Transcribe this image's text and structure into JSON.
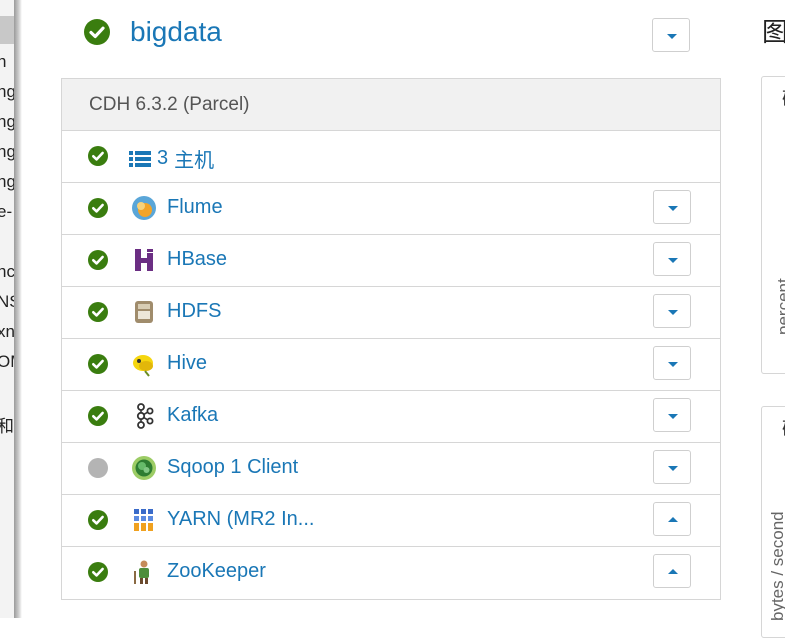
{
  "left_fragments": [
    "n",
    "ng",
    "ng",
    "ng",
    "ng",
    "e-",
    "nc",
    "NS",
    "xn",
    "OM",
    "和"
  ],
  "cluster": {
    "name": "bigdata",
    "status": "good"
  },
  "panel": {
    "header": "CDH 6.3.2 (Parcel)",
    "hosts": {
      "count": "3",
      "label": "主机"
    },
    "services": [
      {
        "name": "Flume",
        "icon": "flume-icon",
        "status": "good",
        "menu": "down"
      },
      {
        "name": "HBase",
        "icon": "hbase-icon",
        "status": "good",
        "menu": "down"
      },
      {
        "name": "HDFS",
        "icon": "hdfs-icon",
        "status": "good",
        "menu": "down"
      },
      {
        "name": "Hive",
        "icon": "hive-icon",
        "status": "good",
        "menu": "down"
      },
      {
        "name": "Kafka",
        "icon": "kafka-icon",
        "status": "good",
        "menu": "down"
      },
      {
        "name": "Sqoop 1 Client",
        "icon": "sqoop-icon",
        "status": "none",
        "menu": "down"
      },
      {
        "name": "YARN (MR2 In...",
        "icon": "yarn-icon",
        "status": "good",
        "menu": "up"
      },
      {
        "name": "ZooKeeper",
        "icon": "zookeeper-icon",
        "status": "good",
        "menu": "up"
      }
    ]
  },
  "right": {
    "title": "图",
    "card1": {
      "corner": "础",
      "ylabel": "percent"
    },
    "card2": {
      "corner": "础",
      "ylabel": "bytes / second"
    }
  },
  "colors": {
    "link": "#1a77b6",
    "good": "#3a7d0f",
    "none": "#b4b4b4"
  }
}
